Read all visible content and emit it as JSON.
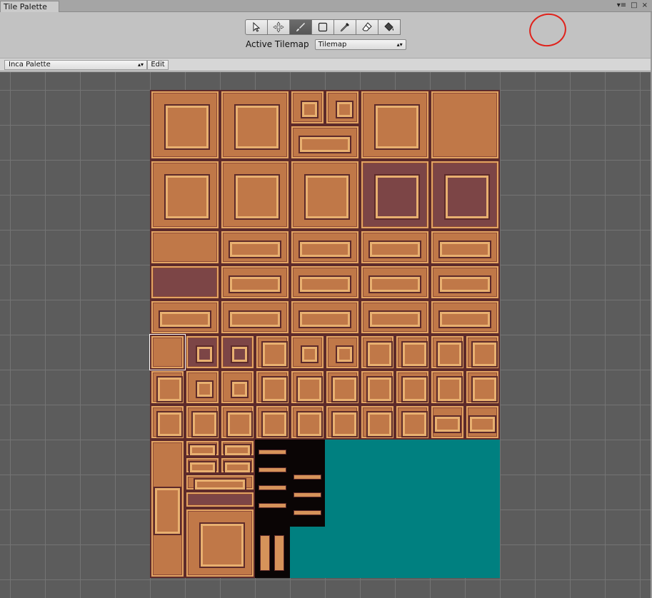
{
  "window": {
    "tab_title": "Tile Palette",
    "controls": [
      "▾≡",
      "□",
      "×"
    ]
  },
  "toolbar": {
    "tools": [
      {
        "name": "select-tool",
        "icon": "pointer-icon",
        "active": false
      },
      {
        "name": "move-tool",
        "icon": "move-icon",
        "active": false
      },
      {
        "name": "paint-brush-tool",
        "icon": "paint-brush-icon",
        "active": true
      },
      {
        "name": "box-fill-tool",
        "icon": "box-fill-icon",
        "active": false
      },
      {
        "name": "picker-tool",
        "icon": "eyedropper-icon",
        "active": false
      },
      {
        "name": "eraser-tool",
        "icon": "eraser-icon",
        "active": false
      },
      {
        "name": "fill-tool",
        "icon": "paint-bucket-icon",
        "active": false
      }
    ],
    "active_tilemap_label": "Active Tilemap",
    "active_tilemap_value": "Tilemap"
  },
  "palette_bar": {
    "palette_name": "Inca Palette",
    "edit_label": "Edit"
  },
  "colors": {
    "grid_bg": "#5c5c5c",
    "grid_line": "#747474",
    "empty_tile": "#008080",
    "brick": "#c07848",
    "outline": "#5d2a2a",
    "annotation": "#e0221b"
  }
}
